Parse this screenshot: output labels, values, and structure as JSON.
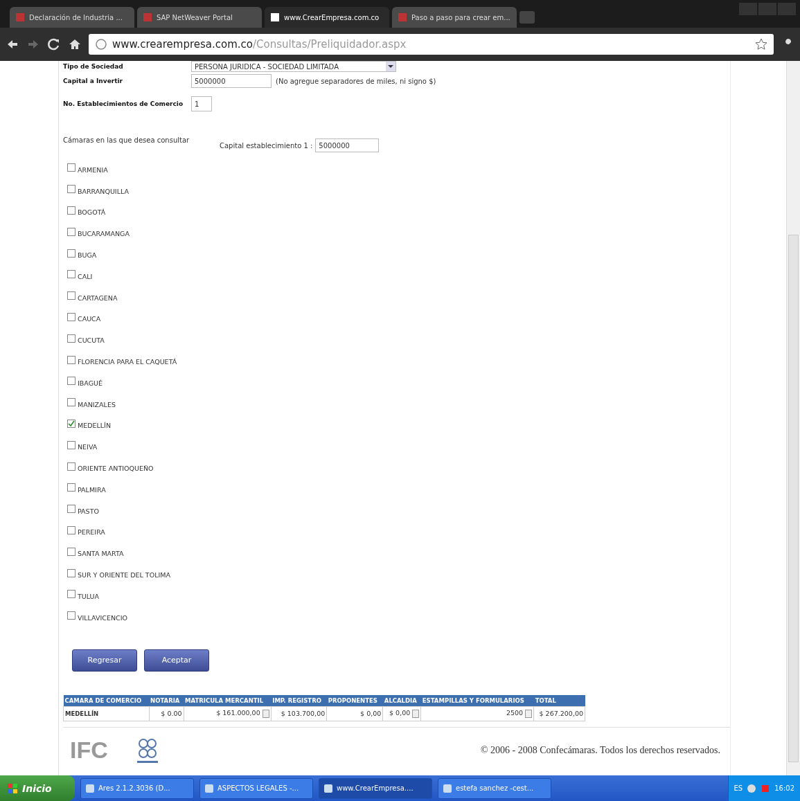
{
  "browser": {
    "tabs": [
      {
        "title": "Declaración de Industria ...",
        "selected": false
      },
      {
        "title": "SAP NetWeaver Portal",
        "selected": false
      },
      {
        "title": "www.CrearEmpresa.com.co",
        "selected": true
      },
      {
        "title": "Paso a paso para crear em...",
        "selected": false
      }
    ],
    "url_host": "www.crearempresa.com.co",
    "url_path": "/Consultas/Preliquidador.aspx"
  },
  "form": {
    "tipo_label": "Tipo de Sociedad",
    "tipo_value": "PERSONA JURIDICA - SOCIEDAD LIMITADA",
    "capital_label": "Capital a Invertir",
    "capital_value": "5000000",
    "capital_hint": "(No agregue separadores de miles, ni signo $)",
    "establecimientos_label": "No. Establecimientos de Comercio",
    "establecimientos_value": "1",
    "camaras_label": "Cámaras en las que desea consultar",
    "capital_est_label": "Capital establecimiento 1 :",
    "capital_est_value": "5000000"
  },
  "camaras": [
    {
      "name": "ARMENIA",
      "checked": false
    },
    {
      "name": "BARRANQUILLA",
      "checked": false
    },
    {
      "name": "BOGOTÁ",
      "checked": false
    },
    {
      "name": "BUCARAMANGA",
      "checked": false
    },
    {
      "name": "BUGA",
      "checked": false
    },
    {
      "name": "CALI",
      "checked": false
    },
    {
      "name": "CARTAGENA",
      "checked": false
    },
    {
      "name": "CAUCA",
      "checked": false
    },
    {
      "name": "CUCUTA",
      "checked": false
    },
    {
      "name": "FLORENCIA PARA EL CAQUETÁ",
      "checked": false
    },
    {
      "name": "IBAGUÉ",
      "checked": false
    },
    {
      "name": "MANIZALES",
      "checked": false
    },
    {
      "name": "MEDELLÍN",
      "checked": true
    },
    {
      "name": "NEIVA",
      "checked": false
    },
    {
      "name": "ORIENTE ANTIOQUEÑO",
      "checked": false
    },
    {
      "name": "PALMIRA",
      "checked": false
    },
    {
      "name": "PASTO",
      "checked": false
    },
    {
      "name": "PEREIRA",
      "checked": false
    },
    {
      "name": "SANTA MARTA",
      "checked": false
    },
    {
      "name": "SUR Y ORIENTE DEL TOLIMA",
      "checked": false
    },
    {
      "name": "TULUA",
      "checked": false
    },
    {
      "name": "VILLAVICENCIO",
      "checked": false
    }
  ],
  "buttons": [
    "Regresar",
    "Aceptar"
  ],
  "table": {
    "columns": [
      "CAMARA DE COMERCIO",
      "NOTARIA",
      "MATRICULA MERCANTIL",
      "IMP. REGISTRO",
      "PROPONENTES",
      "ALCALDIA",
      "ESTAMPILLAS Y FORMULARIOS",
      "TOTAL"
    ],
    "rows": [
      {
        "cells": [
          {
            "text": "MEDELLÍN",
            "detail": false
          },
          {
            "text": "$ 0.00",
            "detail": false
          },
          {
            "text": "$ 161.000,00",
            "detail": true
          },
          {
            "text": "$ 103.700,00",
            "detail": false
          },
          {
            "text": "$ 0,00",
            "detail": false
          },
          {
            "text": "$ 0,00",
            "detail": true
          },
          {
            "text": "2500",
            "detail": true
          },
          {
            "text": "$ 267.200,00",
            "detail": false
          }
        ]
      }
    ]
  },
  "footer": {
    "logo": "IFC",
    "copyright": "© 2006 - 2008 Confecámaras. Todos los derechos reservados."
  },
  "taskbar": {
    "start": "Inicio",
    "items": [
      {
        "label": "Ares 2.1.2.3036 (D...",
        "selected": false
      },
      {
        "label": "ASPECTOS LEGALES -...",
        "selected": false
      },
      {
        "label": "www.CrearEmpresa....",
        "selected": true
      },
      {
        "label": "estefa sanchez -cest...",
        "selected": false
      }
    ],
    "language": "ES",
    "clock": "16:02"
  }
}
